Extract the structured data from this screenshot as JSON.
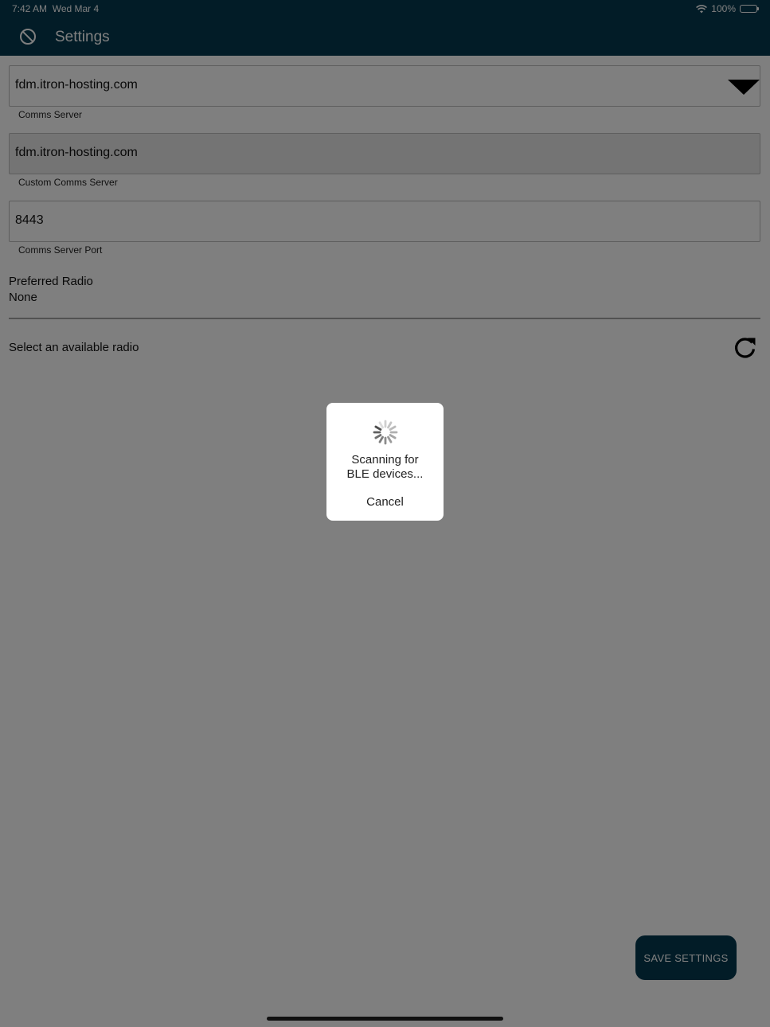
{
  "status_bar": {
    "time": "7:42 AM",
    "date": "Wed Mar 4",
    "battery": "100%"
  },
  "nav": {
    "title": "Settings",
    "icon": "block-icon"
  },
  "fields": {
    "comms_server": {
      "value": "fdm.itron-hosting.com",
      "caption": "Comms Server"
    },
    "custom_comms_server": {
      "value": "fdm.itron-hosting.com",
      "caption": "Custom Comms Server"
    },
    "comms_server_port": {
      "value": "8443",
      "caption": "Comms Server Port"
    }
  },
  "preferred_radio": {
    "label": "Preferred Radio",
    "value": "None"
  },
  "select_radio": {
    "label": "Select an available radio",
    "refresh_icon": "refresh-icon"
  },
  "save_button": {
    "label": "SAVE SETTINGS"
  },
  "dialog": {
    "message_line1": "Scanning for",
    "message_line2": "BLE devices...",
    "cancel_label": "Cancel"
  },
  "colors": {
    "primary": "#04394f",
    "overlay": "rgba(0,0,0,0.5)"
  }
}
